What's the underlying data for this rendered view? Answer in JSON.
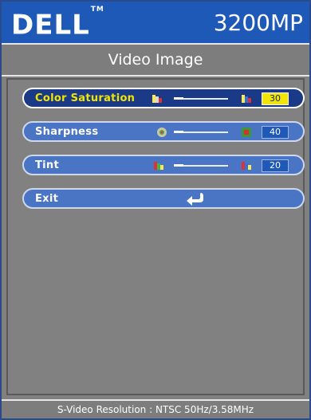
{
  "header": {
    "logo_text": "DELL",
    "logo_tm": "TM",
    "model": "3200MP"
  },
  "subheader": {
    "title": "Video Image"
  },
  "menu": {
    "items": [
      {
        "label": "Color Saturation",
        "value": "30",
        "selected": true
      },
      {
        "label": "Sharpness",
        "value": "40",
        "selected": false
      },
      {
        "label": "Tint",
        "value": "20",
        "selected": false
      },
      {
        "label": "Exit",
        "selected": false
      }
    ]
  },
  "footer": {
    "text": "S-Video Resolution : NTSC 50Hz/3.58MHz"
  },
  "colors": {
    "header_blue": "#1e59b8",
    "selected_yellow": "#f2e600",
    "panel_gray": "#818181"
  }
}
